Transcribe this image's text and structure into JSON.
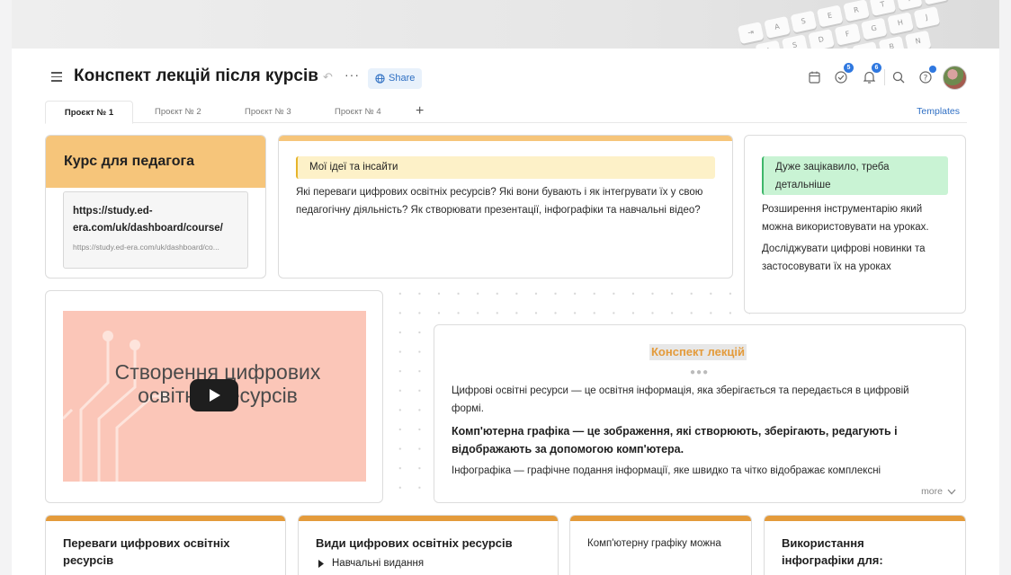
{
  "header": {
    "title": "Конспект лекцій після курсів",
    "share_label": "Share",
    "tasks_badge": "5",
    "notifications_badge": "6"
  },
  "tabs": [
    {
      "label": "Проєкт № 1"
    },
    {
      "label": "Проєкт № 2"
    },
    {
      "label": "Проєкт № 3"
    },
    {
      "label": "Проєкт № 4"
    }
  ],
  "templates_label": "Templates",
  "course_card": {
    "title": "Курс для педагога",
    "link_title": "https://study.ed-era.com/uk/dashboard/course/",
    "link_url": "https://study.ed-era.com/uk/dashboard/co..."
  },
  "ideas_card": {
    "highlight": "Мої ідеї та інсайти",
    "text": "Які переваги цифрових освітніх ресурсів? Які вони бувають і як інтегрувати їх у свою педагогічну діяльність? Як створювати презентації, інфографіки та навчальні відео?"
  },
  "interest_card": {
    "highlight": "Дуже зацікавило, треба детальніше",
    "p1": "Розширення інструментарію який можна використовувати на уроках.",
    "p2": "Досліджувати цифрові новинки та застосовувати їх на уроках"
  },
  "video_card": {
    "thumbnail_text": "Створення цифрових освітніх ресурсів"
  },
  "lecture_card": {
    "title": "Конспект лекцій",
    "p1": "Цифрові освітні ресурси  — це освітня інформація, яка зберігається та передається в цифровій формі.",
    "p2": "Комп'ютерна графіка — це зображення, які створюють, зберігають, редагують і відображають за допомогою комп'ютера.",
    "p3": "Інфографіка — графічне подання інформації, яке швидко та чітко відображає комплексні",
    "more_label": "more"
  },
  "bottom_cards": [
    {
      "title": "Переваги цифрових освітніх ресурсів"
    },
    {
      "title": "Види цифрових освітніх ресурсів",
      "item": "Навчальні видання"
    },
    {
      "text": "Комп'ютерну графіку можна"
    },
    {
      "title": "Використання інфографіки для:"
    }
  ],
  "colors": {
    "orange_header": "#f6c57a",
    "orange_bar": "#e49b3b",
    "yellow_highlight": "#fdf1c8",
    "green_highlight": "#c9f3d4",
    "accent_blue": "#2f6fc4",
    "video_bg": "#fbc6b8"
  },
  "icons": [
    "menu-icon",
    "undo-icon",
    "more-icon",
    "globe-icon",
    "calendar-icon",
    "tasks-icon",
    "bell-icon",
    "search-icon",
    "help-icon",
    "play-icon",
    "chevron-down-icon",
    "triangle-right-icon"
  ]
}
